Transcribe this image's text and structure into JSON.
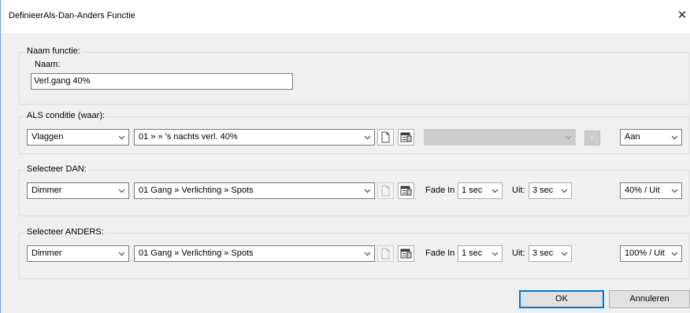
{
  "window": {
    "title": "DefinieerAls-Dan-Anders Functie"
  },
  "name_group": {
    "legend": "Naam functie:",
    "name_label": "Naam:",
    "name_value": "Verl.gang 40%"
  },
  "if_group": {
    "legend": "ALS conditie (waar):",
    "type": "Vlaggen",
    "item": "01  » » 's nachts verl. 40%",
    "compare_value": "",
    "operator": "=",
    "state": "Aan"
  },
  "then_group": {
    "legend": "Selecteer DAN:",
    "type": "Dimmer",
    "item": "01 Gang » Verlichting » Spots",
    "fade_in_label": "Fade In",
    "fade_in": "1 sec",
    "off_label": "Uit:",
    "off_time": "3 sec",
    "level": "40% / Uit"
  },
  "else_group": {
    "legend": "Selecteer ANDERS:",
    "type": "Dimmer",
    "item": "01 Gang » Verlichting » Spots",
    "fade_in_label": "Fade In",
    "fade_in": "1 sec",
    "off_label": "Uit:",
    "off_time": "3 sec",
    "level": "100% / Uit"
  },
  "buttons": {
    "ok": "OK",
    "cancel": "Annuleren"
  },
  "icons": {
    "new": "new-document-icon",
    "properties": "properties-icon",
    "chevron": "chevron-down-icon",
    "close": "close-icon"
  },
  "colors": {
    "accent": "#0078d7",
    "frame": "#6f9fd6",
    "background": "#f0f0f0"
  }
}
